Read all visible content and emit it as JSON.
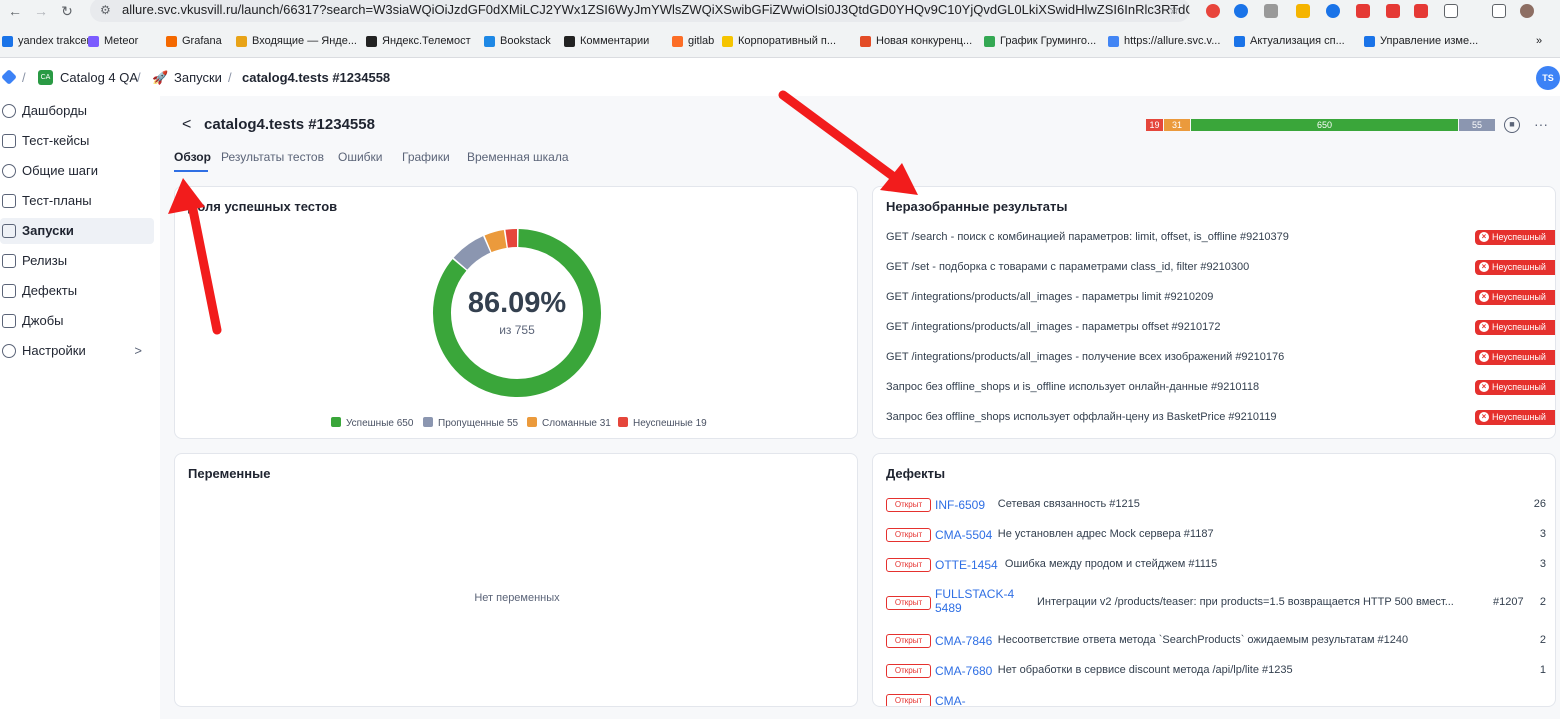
{
  "browser": {
    "url": "allure.svc.vkusvill.ru/launch/66317?search=W3siaWQiOiJzdGF0dXMiLCJ2YWx1ZSI6WyJmYWlsZWQiXSwibGFiZWwiOlsi0J3QtdGD0YHQv9C10YjQvdGL0LkiXSwidHlwZSI6InRlc3RTdGF0d...",
    "bookmarks": [
      "yandex trakcer",
      "Meteor",
      "Grafana",
      "Входящие — Янде...",
      "Яндекс.Телемост",
      "Bookstack",
      "Комментарии",
      "gitlab",
      "Корпоративный п...",
      "Новая конкуренц...",
      "График Груминго...",
      "https://allure.svc.v...",
      "Актуализация сп...",
      "Управление изме..."
    ],
    "bookmark_colors": [
      "#1a73e8",
      "#7b5cff",
      "#f46800",
      "#e8a317",
      "#222",
      "#1e88e5",
      "#222",
      "#fc6d26",
      "#f5c400",
      "#e34c26",
      "#34a853",
      "#4285f4",
      "#1a73e8",
      "#1a73e8"
    ],
    "more": "»"
  },
  "appbar": {
    "project_badge": "CA",
    "project": "Catalog 4 QA",
    "launches": "Запуски",
    "current": "catalog4.tests #1234558",
    "sep": "/",
    "avatar": "TS"
  },
  "sidebar": {
    "items": [
      {
        "label": "Дашборды",
        "icon": "clock-icon"
      },
      {
        "label": "Тест-кейсы",
        "icon": "code-icon"
      },
      {
        "label": "Общие шаги",
        "icon": "refresh-icon"
      },
      {
        "label": "Тест-планы",
        "icon": "clipboard-icon"
      },
      {
        "label": "Запуски",
        "icon": "rocket-icon"
      },
      {
        "label": "Релизы",
        "icon": "box-icon"
      },
      {
        "label": "Дефекты",
        "icon": "bug-icon"
      },
      {
        "label": "Джобы",
        "icon": "terminal-icon"
      },
      {
        "label": "Настройки",
        "icon": "gear-icon"
      }
    ],
    "chevron": ">"
  },
  "page": {
    "back": "<",
    "title": "catalog4.tests #1234558",
    "tabs": [
      "Обзор",
      "Результаты тестов",
      "Ошибки",
      "Графики",
      "Временная шкала"
    ],
    "stats": [
      {
        "value": "19",
        "color": "#e5463b"
      },
      {
        "value": "31",
        "color": "#eb9a3c"
      },
      {
        "value": "650",
        "color": "#3aa63a"
      },
      {
        "value": "55",
        "color": "#8b96b0"
      }
    ],
    "more": "···"
  },
  "success_card": {
    "title": "Доля успешных тестов",
    "percent": "86.09%",
    "total": "из 755",
    "segments": [
      {
        "label": "Успешные",
        "value": 650,
        "color": "#3aa63a"
      },
      {
        "label": "Пропущенные",
        "value": 55,
        "color": "#8b96b0"
      },
      {
        "label": "Сломанные",
        "value": 31,
        "color": "#eb9a3c"
      },
      {
        "label": "Неуспешные",
        "value": 19,
        "color": "#e5463b"
      }
    ],
    "legend": [
      "Успешные 650",
      "Пропущенные 55",
      "Сломанные 31",
      "Неуспешные 19"
    ]
  },
  "unresolved": {
    "title": "Неразобранные результаты",
    "status": "Неуспешный",
    "rows": [
      "GET /search - поиск с комбинацией параметров: limit, offset, is_offline #9210379",
      "GET /set - подборка с товарами с параметрами class_id, filter #9210300",
      "GET /integrations/products/all_images - параметры limit #9210209",
      "GET /integrations/products/all_images - параметры offset #9210172",
      "GET /integrations/products/all_images - получение всех изображений #9210176",
      "Запрос без offline_shops и is_offline использует онлайн-данные #9210118",
      "Запрос без offline_shops использует оффлайн-цену из BasketPrice #9210119"
    ]
  },
  "variables": {
    "title": "Переменные",
    "empty": "Нет переменных"
  },
  "defects": {
    "title": "Дефекты",
    "status": "Открыт",
    "rows": [
      {
        "key": "INF-6509",
        "desc": "Сетевая связанность #1215",
        "count": "26"
      },
      {
        "key": "CMA-5504",
        "desc": "Не установлен адрес Mock сервера #1187",
        "count": "3"
      },
      {
        "key": "OTTE-1454",
        "desc": "Ошибка между продом и стейджем #1115",
        "count": "3"
      },
      {
        "key": "FULLSTACK-45489",
        "desc": "Интеграции v2 /products/teaser: при products=1.5 возвращается HTTP 500 вмест...",
        "id": "#1207",
        "count": "2"
      },
      {
        "key": "CMA-7846",
        "desc": "Несоответствие ответа метода `SearchProducts` ожидаемым результатам #1240",
        "count": "2"
      },
      {
        "key": "CMA-7680",
        "desc": "Нет обработки в сервисе discount метода /api/lp/lite #1235",
        "count": "1"
      },
      {
        "key": "CMA-",
        "desc": "",
        "count": ""
      }
    ]
  }
}
